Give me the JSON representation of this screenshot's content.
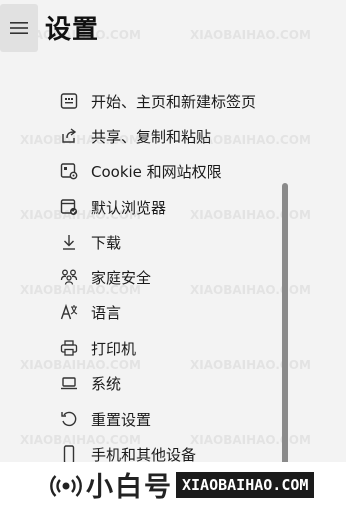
{
  "header": {
    "title": "设置"
  },
  "nav": {
    "items": [
      {
        "label": "开始、主页和新建标签页",
        "icon": "start-page-icon"
      },
      {
        "label": "共享、复制和粘贴",
        "icon": "share-icon"
      },
      {
        "label": "Cookie 和网站权限",
        "icon": "cookie-permissions-icon"
      },
      {
        "label": "默认浏览器",
        "icon": "default-browser-icon"
      },
      {
        "label": "下载",
        "icon": "download-icon"
      },
      {
        "label": "家庭安全",
        "icon": "family-icon"
      },
      {
        "label": "语言",
        "icon": "language-icon"
      },
      {
        "label": "打印机",
        "icon": "printer-icon"
      },
      {
        "label": "系统",
        "icon": "laptop-icon"
      },
      {
        "label": "重置设置",
        "icon": "reset-icon"
      },
      {
        "label": "手机和其他设备",
        "icon": "phone-icon"
      }
    ]
  },
  "watermark": {
    "cn": "小白号",
    "en": "XIAOBAIHAO.COM"
  }
}
